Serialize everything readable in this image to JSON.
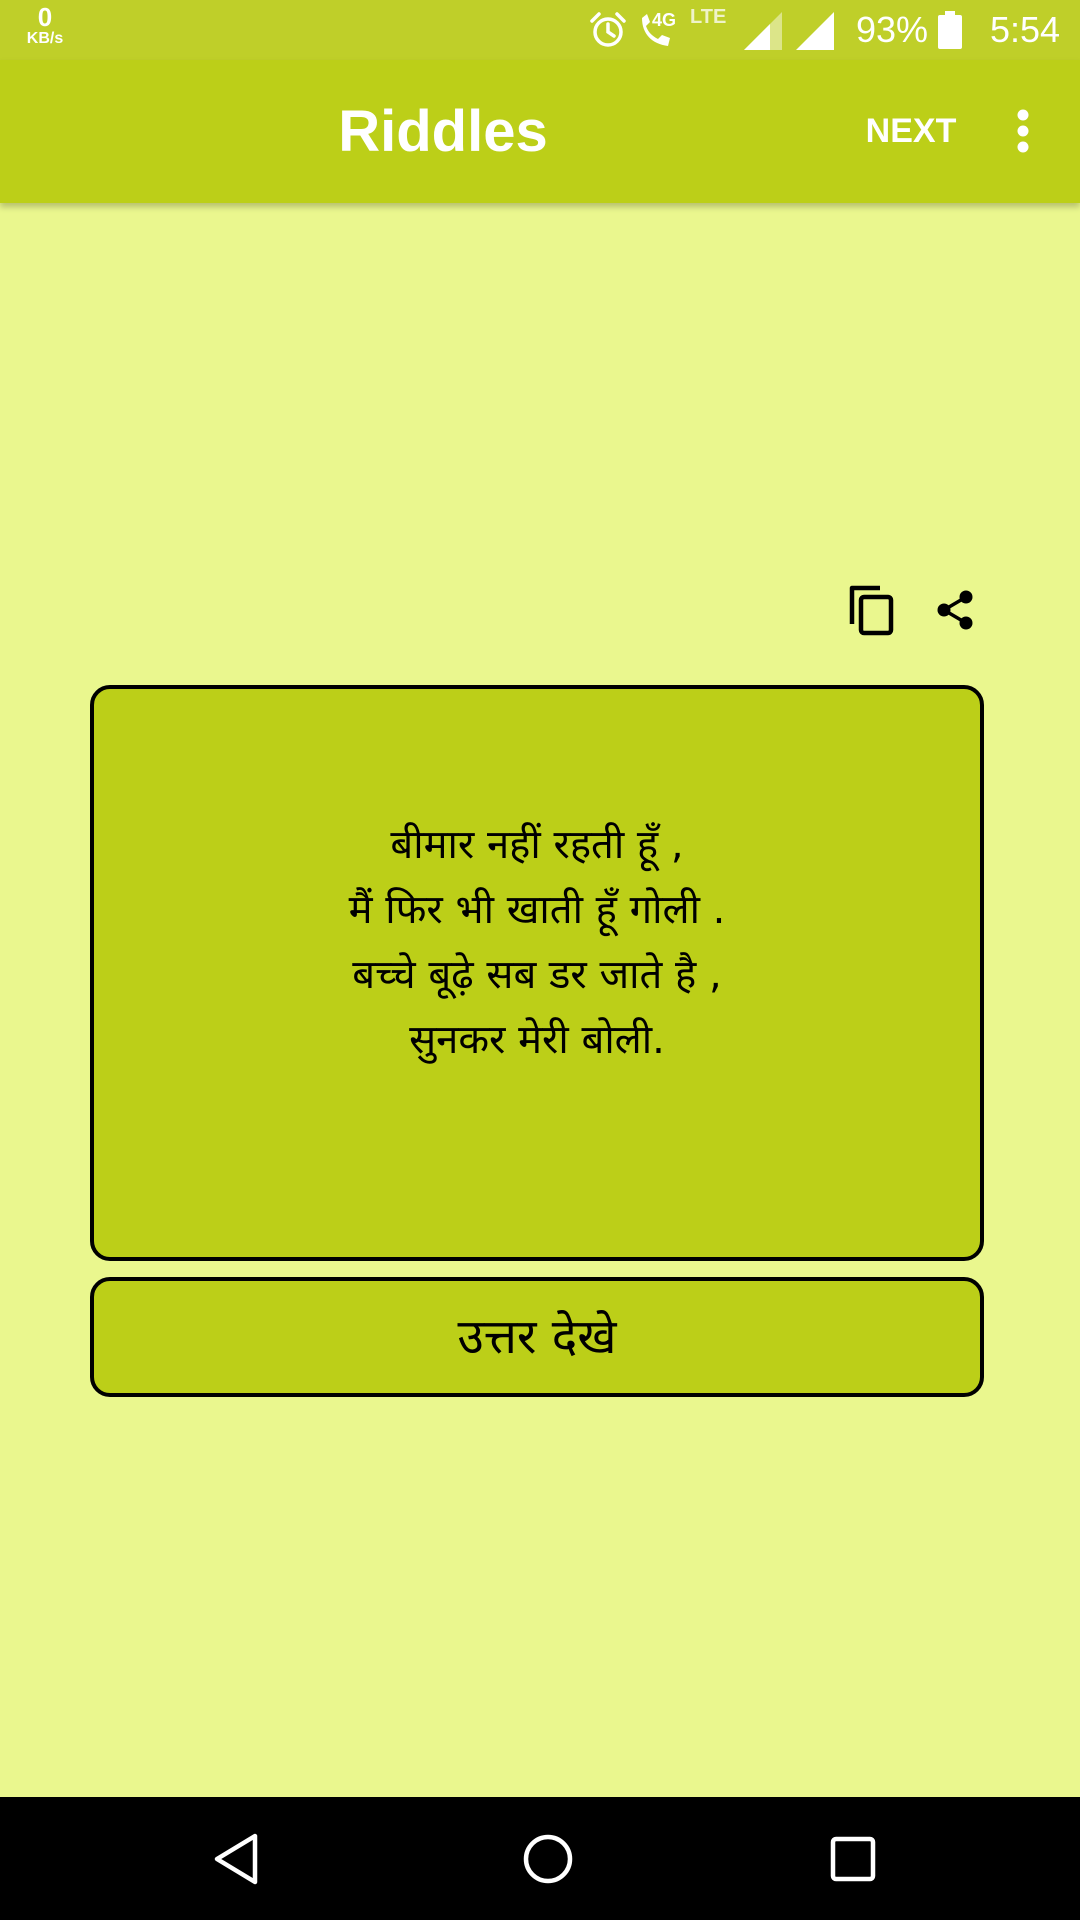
{
  "status_bar": {
    "net_speed_value": "0",
    "net_speed_unit": "KB/s",
    "network_badge": "4G",
    "lte_label": "LTE",
    "battery_percent": "93%",
    "time": "5:54",
    "icons": [
      "alarm-icon",
      "volte-call-icon",
      "signal-icon",
      "signal-icon",
      "battery-icon"
    ]
  },
  "app_bar": {
    "title": "Riddles",
    "next_label": "NEXT",
    "menu_icon": "more-vert-icon"
  },
  "actions": {
    "copy_icon": "copy-icon",
    "share_icon": "share-icon"
  },
  "riddle": {
    "lines": [
      "बीमार नहीं रहती हूँ ,",
      "मैं फिर भी खाती हूँ गोली .",
      "बच्चे बूढ़े सब डर जाते है ,",
      "सुनकर मेरी बोली."
    ]
  },
  "answer_button": {
    "label": "उत्तर देखे"
  },
  "nav_bar": {
    "icons": [
      "back-icon",
      "home-icon",
      "recents-icon"
    ]
  },
  "colors": {
    "status_bar": "#BFCF29",
    "app_bar": "#BCCF18",
    "background": "#EAF78E",
    "card": "#BCCF18",
    "border": "#000000"
  }
}
